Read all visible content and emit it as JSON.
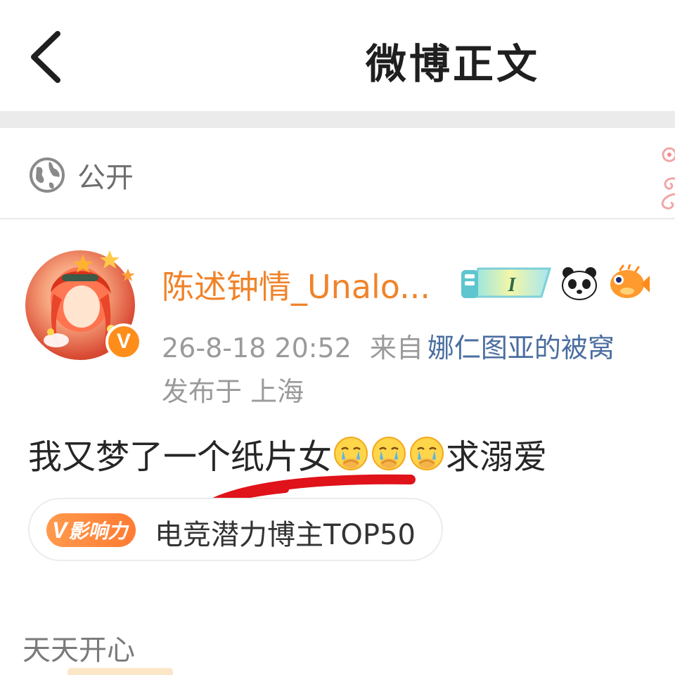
{
  "header": {
    "title": "微博正文"
  },
  "visibility": {
    "label": "公开",
    "icon": "globe-icon"
  },
  "author": {
    "name": "陈述钟情_Unalo...",
    "verified_badge": "V",
    "member_level": "I",
    "timestamp": "26-8-18 20:52",
    "source_label": "来自",
    "source_name": "娜仁图亚的被窝",
    "location": "发布于 上海"
  },
  "post": {
    "text_before": "我又梦了一个纸片女",
    "text_after": "求溺爱",
    "emoji_count": 3,
    "emoji_name": "crying-face-emoji"
  },
  "influence": {
    "badge_v": "V",
    "badge_label": "影响力",
    "text": "电竞潜力博主TOP50"
  },
  "footer": {
    "text": "天天开心"
  },
  "colors": {
    "accent_orange": "#f0832a",
    "link_blue": "#4b6ea0",
    "annotation_red": "#e0121a",
    "separator_gray": "#ebebeb"
  }
}
